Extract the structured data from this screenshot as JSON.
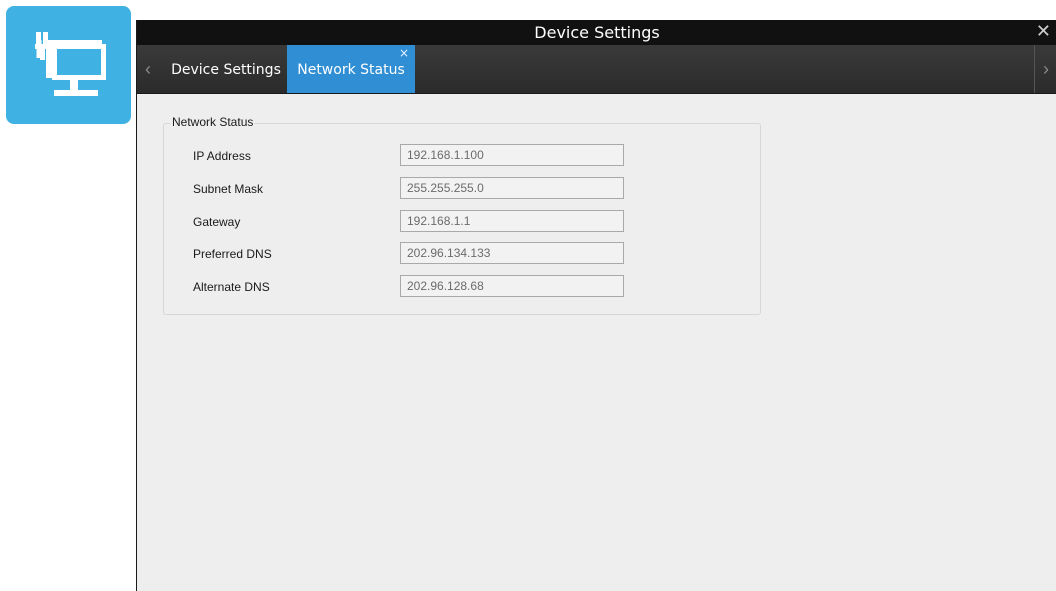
{
  "window": {
    "title": "Device Settings",
    "close_glyph": "✕"
  },
  "tabs": [
    {
      "label": "Device Settings",
      "active": false
    },
    {
      "label": "Network Status",
      "active": true,
      "close_glyph": "×"
    }
  ],
  "nav": {
    "prev_glyph": "‹",
    "next_glyph": "›"
  },
  "network_status": {
    "group_label": "Network Status",
    "fields": [
      {
        "label": "IP Address",
        "value": "192.168.1.100"
      },
      {
        "label": "Subnet Mask",
        "value": "255.255.255.0"
      },
      {
        "label": "Gateway",
        "value": "192.168.1.1"
      },
      {
        "label": "Preferred DNS",
        "value": "202.96.134.133"
      },
      {
        "label": "Alternate DNS",
        "value": "202.96.128.68"
      }
    ]
  },
  "colors": {
    "accent": "#2f8ed4",
    "app_icon_bg": "#3fb1e3",
    "titlebar": "#111111"
  },
  "icons": {
    "app_icon": "network-monitor-icon"
  }
}
